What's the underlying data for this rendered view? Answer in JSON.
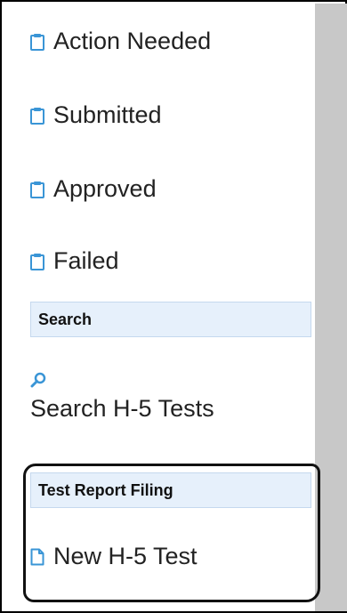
{
  "sidebar": {
    "status_items": [
      {
        "label": "Action Needed",
        "icon": "clipboard-icon"
      },
      {
        "label": "Submitted",
        "icon": "clipboard-icon"
      },
      {
        "label": "Approved",
        "icon": "clipboard-icon"
      },
      {
        "label": "Failed",
        "icon": "clipboard-icon"
      }
    ],
    "search_section": {
      "header": "Search",
      "link_label": "Search H-5 Tests",
      "icon": "magnifier-icon"
    },
    "filing_section": {
      "header": "Test Report Filing",
      "link_label": "New H-5 Test",
      "icon": "document-icon"
    }
  },
  "colors": {
    "icon_blue": "#3a95d6",
    "header_bg": "#e6f0fb",
    "header_border": "#c5d8ee",
    "content_gray": "#c8c8c8"
  }
}
